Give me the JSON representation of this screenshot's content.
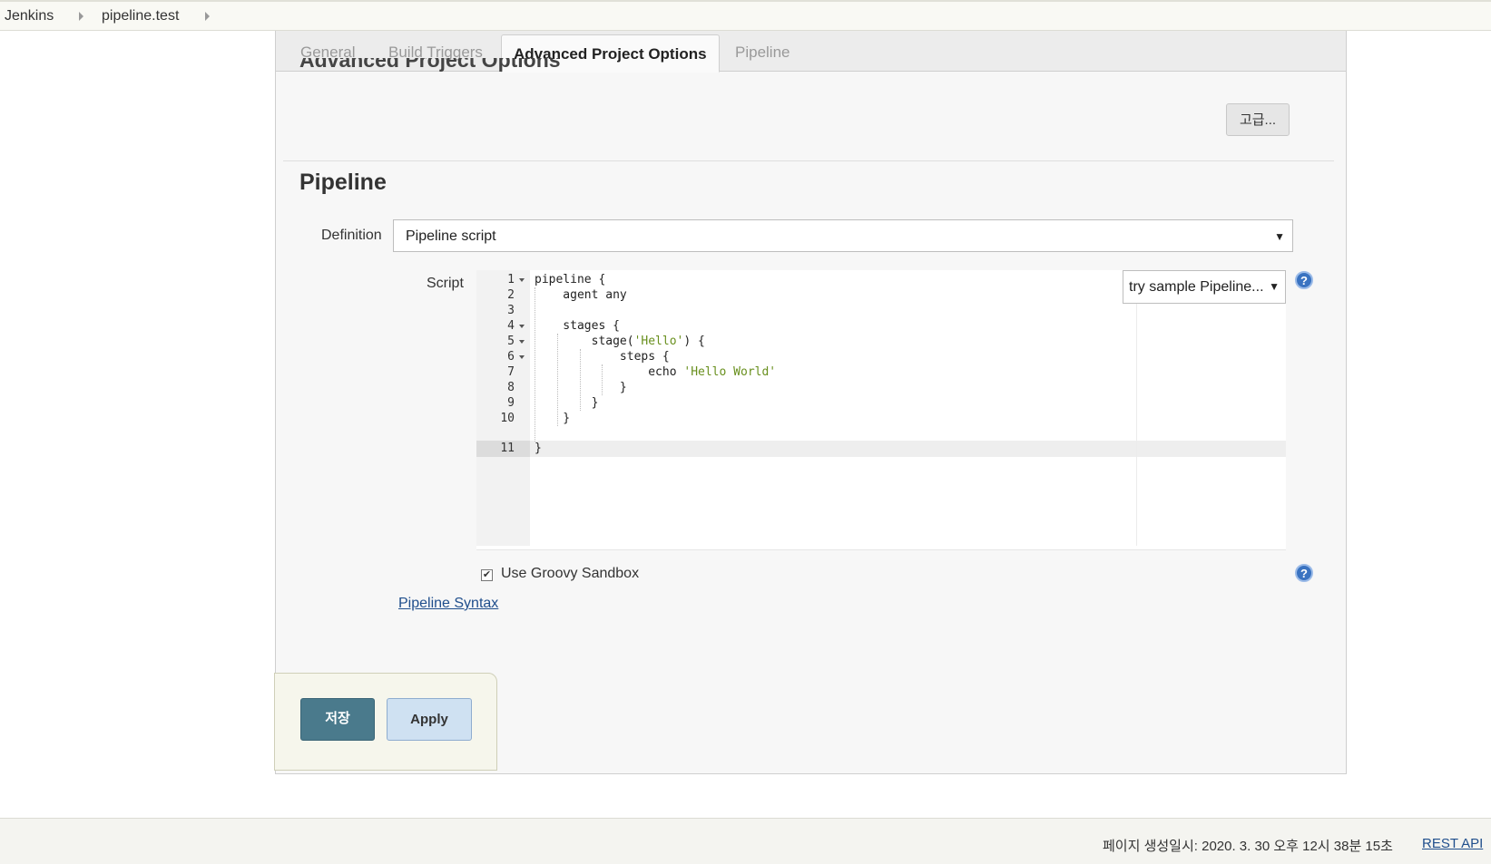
{
  "breadcrumb": {
    "items": [
      "Jenkins",
      "pipeline.test"
    ]
  },
  "tabs": [
    {
      "label": "General",
      "active": false
    },
    {
      "label": "Build Triggers",
      "active": false
    },
    {
      "label": "Advanced Project Options",
      "active": true
    },
    {
      "label": "Pipeline",
      "active": false
    }
  ],
  "advanced_section": {
    "heading": "Advanced Project Options",
    "advanced_button": "고급..."
  },
  "pipeline": {
    "title": "Pipeline",
    "definition_label": "Definition",
    "definition_value": "Pipeline script",
    "script_label": "Script",
    "sample_select": "try sample Pipeline...",
    "code": {
      "line_numbers": [
        "1",
        "2",
        "3",
        "4",
        "5",
        "6",
        "7",
        "8",
        "9",
        "10",
        "11"
      ],
      "lines": [
        "pipeline {",
        "    agent any",
        "",
        "    stages {",
        "        stage(",
        "            steps {",
        "                echo ",
        "            }",
        "        }",
        "    }",
        "}"
      ],
      "strings": {
        "stage_name": "'Hello'",
        "stage_tail": ") {",
        "echo_text": "'Hello World'"
      },
      "active_line": "11"
    },
    "sandbox_label": "Use Groovy Sandbox",
    "sandbox_checked": true,
    "syntax_link": "Pipeline Syntax"
  },
  "actions": {
    "save": "저장",
    "apply": "Apply"
  },
  "footer": {
    "generated": "페이지 생성일시: 2020. 3. 30 오후 12시 38분 15초",
    "rest_api": "REST API"
  },
  "icons": {
    "help": "question-help-icon",
    "chevron": "chevron-right-icon",
    "dropdown": "dropdown-caret-icon"
  }
}
